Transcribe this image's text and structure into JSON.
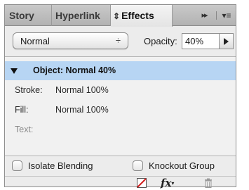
{
  "tabs": {
    "story": "Story",
    "hyperlink": "Hyperlink",
    "effects": "Effects",
    "effects_sort_glyph": "⇕",
    "overflow_glyph": "▸▸",
    "menu_glyph": "▾≡"
  },
  "blend": {
    "mode": "Normal",
    "arrows": "÷"
  },
  "opacity": {
    "label": "Opacity:",
    "value": "40%"
  },
  "effects_list": {
    "object_label": "Object: Normal 40%",
    "stroke_key": "Stroke:",
    "stroke_value": "Normal 100%",
    "fill_key": "Fill:",
    "fill_value": "Normal 100%",
    "text_key": "Text:",
    "selected_color": "#b7d5f3"
  },
  "options": {
    "isolate_blending": "Isolate Blending",
    "knockout_group": "Knockout Group"
  },
  "footer": {
    "fx_label": "fx",
    "fx_dropdown": "▾"
  },
  "icons": [
    "sort-arrows-icon",
    "overflow-icon",
    "panel-menu-icon",
    "select-arrows-icon",
    "stepper-arrow-icon",
    "disclosure-triangle-icon",
    "clear-effects-icon",
    "fx-icon",
    "trash-icon"
  ]
}
